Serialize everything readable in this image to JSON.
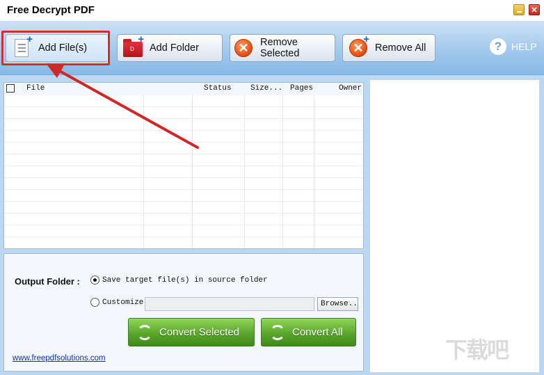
{
  "window": {
    "title": "Free Decrypt PDF"
  },
  "toolbar": {
    "add_files": "Add File(s)",
    "add_folder": "Add Folder",
    "remove_selected": "Remove Selected",
    "remove_all": "Remove All",
    "help": "HELP"
  },
  "file_list": {
    "columns": [
      "File",
      "Status",
      "Size...",
      "Pages",
      "Owner"
    ]
  },
  "output": {
    "label": "Output Folder :",
    "option_source": "Save target file(s) in source folder",
    "option_custom": "Customize",
    "custom_path": "",
    "browse": "Browse..",
    "selected_option": "source"
  },
  "actions": {
    "convert_selected": "Convert Selected",
    "convert_all": "Convert All"
  },
  "footer": {
    "link": "www.freepdfsolutions.com"
  },
  "watermark": "下载吧",
  "colors": {
    "toolbar": "#a9cdee",
    "accent_highlight": "#d52b2b",
    "convert_green": "#5aa62c",
    "link": "#1230a8"
  }
}
